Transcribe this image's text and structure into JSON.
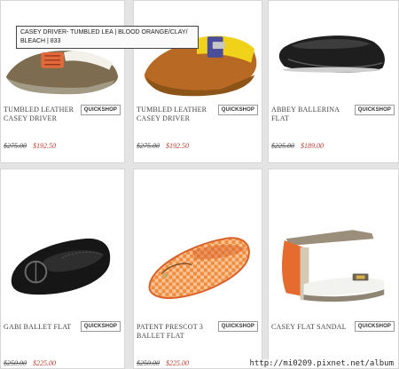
{
  "tooltip": "CASEY DRIVER- TUMBLED LEA | BLOOD ORANGE/CLAY/ BLEACH | 833",
  "quickshop_label": "QUICKSHOP",
  "watermark": "http://mi0209.pixnet.net/album",
  "products": [
    {
      "name": "TUMBLED LEATHER CASEY DRIVER",
      "original_price": "$275.00",
      "sale_price": "$192.50",
      "image_icon": "driver-shoe-green-orange"
    },
    {
      "name": "TUMBLED LEATHER CASEY DRIVER",
      "original_price": "$275.00",
      "sale_price": "$192.50",
      "image_icon": "driver-shoe-yellow-brown"
    },
    {
      "name": "ABBEY BALLERINA FLAT",
      "original_price": "$225.00",
      "sale_price": "$189.00",
      "image_icon": "ballerina-flat-black"
    },
    {
      "name": "GABI BALLET FLAT",
      "original_price": "$250.00",
      "sale_price": "$225.00",
      "image_icon": "ballet-flat-black-logo"
    },
    {
      "name": "PATENT PRESCOT 3 BALLET FLAT",
      "original_price": "$250.00",
      "sale_price": "$225.00",
      "image_icon": "woven-ballet-flat-orange"
    },
    {
      "name": "CASEY FLAT SANDAL",
      "original_price": "",
      "sale_price": "",
      "image_icon": "t-strap-sandal"
    }
  ],
  "colors": {
    "sale_price": "#c0392b",
    "background": "#e4e4e4"
  }
}
